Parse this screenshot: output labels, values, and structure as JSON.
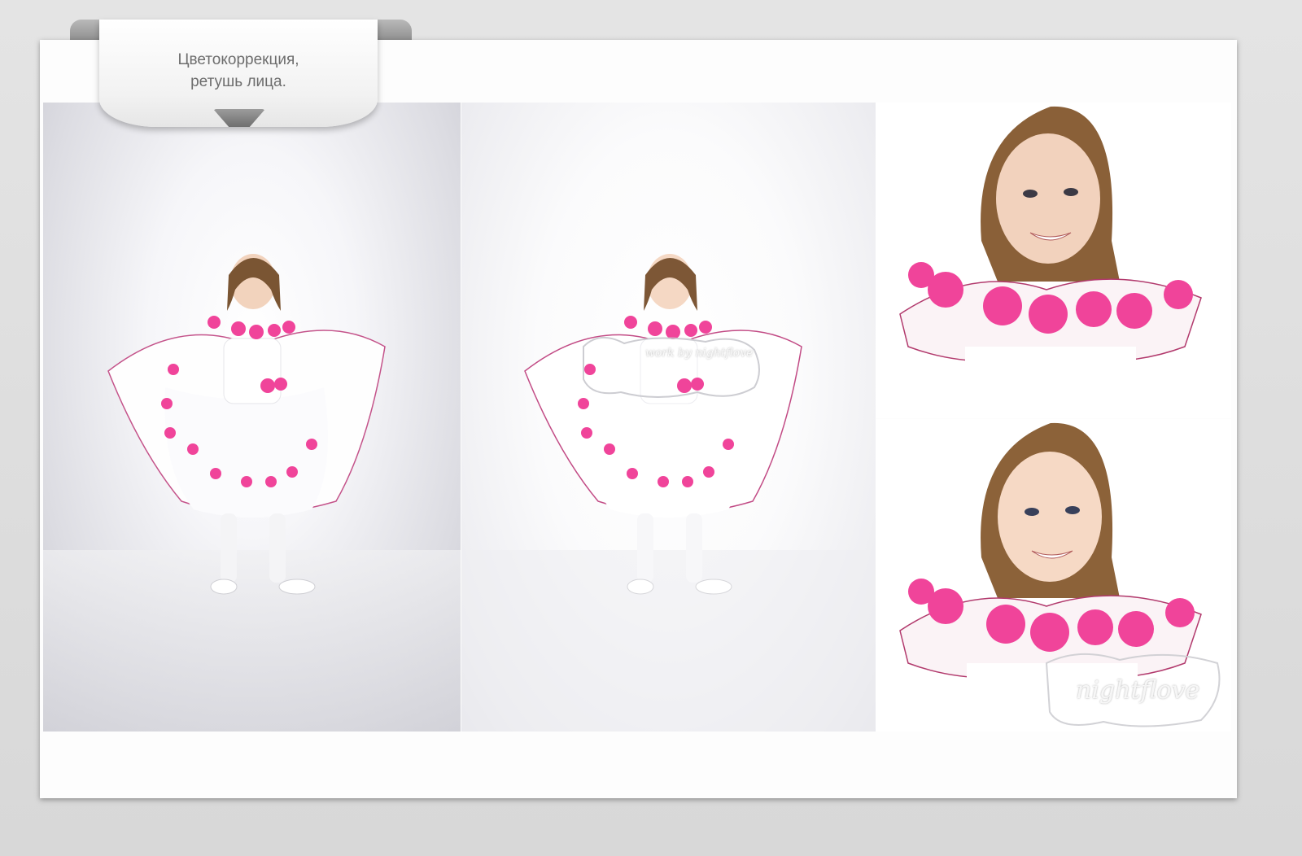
{
  "label": {
    "line1": "Цветокоррекция,",
    "line2": "ретушь лица."
  },
  "photos": [
    {
      "name": "before-full-body",
      "description_icon": "girl-standing-icon"
    },
    {
      "name": "after-full-body",
      "watermark": "work by nightflove"
    },
    {
      "name": "face-closeup-before"
    },
    {
      "name": "face-closeup-after",
      "watermark": "nightflove"
    }
  ],
  "colors": {
    "accent_pink": "#f0449a",
    "label_text": "#6d6d6d",
    "sheet": "#fdfdfd"
  }
}
